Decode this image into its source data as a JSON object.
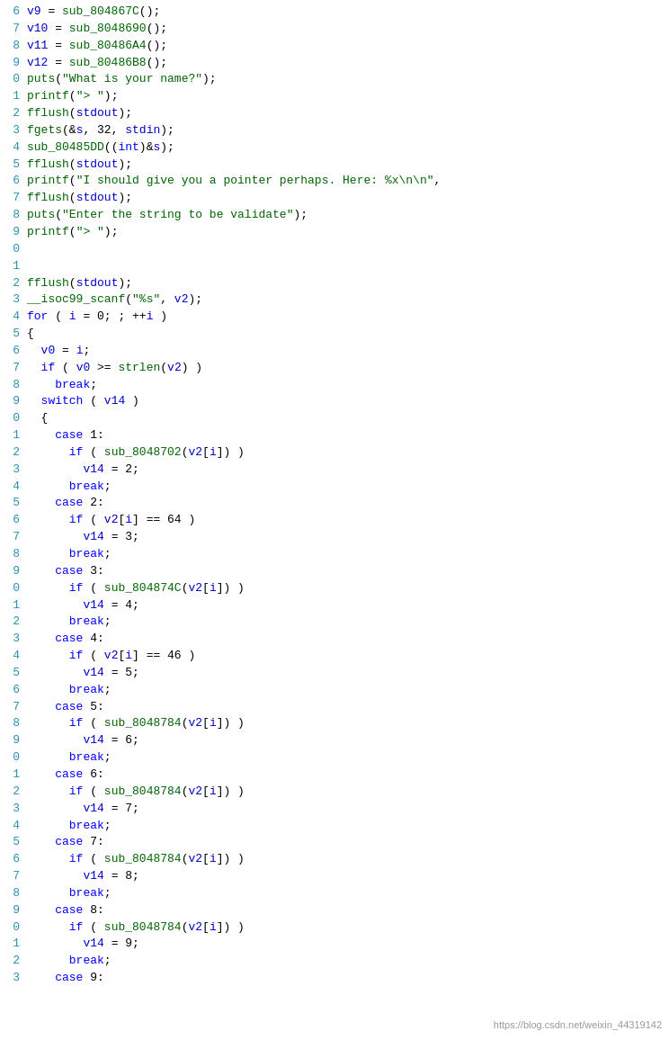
{
  "watermark": "https://blog.csdn.net/weixin_44319142",
  "lines": [
    {
      "num": "6",
      "html": "<span class='var'>v9</span><span class='plain'> = </span><span class='fn'>sub_804867C</span><span class='plain'>();</span>"
    },
    {
      "num": "7",
      "html": "<span class='var'>v10</span><span class='plain'> = </span><span class='fn'>sub_8048690</span><span class='plain'>();</span>"
    },
    {
      "num": "8",
      "html": "<span class='var'>v11</span><span class='plain'> = </span><span class='fn'>sub_80486A4</span><span class='plain'>();</span>"
    },
    {
      "num": "9",
      "html": "<span class='var'>v12</span><span class='plain'> = </span><span class='fn'>sub_80486B8</span><span class='plain'>();</span>"
    },
    {
      "num": "0",
      "html": "<span class='fn'>puts</span><span class='plain'>(</span><span class='str'>\"What is your name?\"</span><span class='plain'>);</span>"
    },
    {
      "num": "1",
      "html": "<span class='fn'>printf</span><span class='plain'>(</span><span class='str'>\"> \"</span><span class='plain'>);</span>"
    },
    {
      "num": "2",
      "html": "<span class='fn'>fflush</span><span class='plain'>(</span><span class='var'>stdout</span><span class='plain'>);</span>"
    },
    {
      "num": "3",
      "html": "<span class='fn'>fgets</span><span class='plain'>(&amp;</span><span class='var'>s</span><span class='plain'>, 32, </span><span class='var'>stdin</span><span class='plain'>);</span>"
    },
    {
      "num": "4",
      "html": "<span class='fn'>sub_80485DD</span><span class='plain'>((</span><span class='kw'>int</span><span class='plain'>)&amp;</span><span class='var'>s</span><span class='plain'>);</span>"
    },
    {
      "num": "5",
      "html": "<span class='fn'>fflush</span><span class='plain'>(</span><span class='var'>stdout</span><span class='plain'>);</span>"
    },
    {
      "num": "6",
      "html": "<span class='fn'>printf</span><span class='plain'>(</span><span class='str'>\"I should give you a pointer perhaps. Here: %x\\n\\n\"</span><span class='plain'>,</span>"
    },
    {
      "num": "7",
      "html": "<span class='fn'>fflush</span><span class='plain'>(</span><span class='var'>stdout</span><span class='plain'>);</span>"
    },
    {
      "num": "8",
      "html": "<span class='fn'>puts</span><span class='plain'>(</span><span class='str'>\"Enter the string to be validate\"</span><span class='plain'>);</span>"
    },
    {
      "num": "9",
      "html": "<span class='fn'>printf</span><span class='plain'>(</span><span class='str'>\"> \"</span><span class='plain'>);</span>"
    },
    {
      "num": "0",
      "html": ""
    },
    {
      "num": "1",
      "html": ""
    },
    {
      "num": "2",
      "html": "<span class='fn'>fflush</span><span class='plain'>(</span><span class='var'>stdout</span><span class='plain'>);</span>"
    },
    {
      "num": "3",
      "html": "<span class='fn'>__isoc99_scanf</span><span class='plain'>(</span><span class='str'>\"%s\"</span><span class='plain'>, </span><span class='var'>v2</span><span class='plain'>);</span>"
    },
    {
      "num": "4",
      "html": "<span class='kw'>for</span><span class='plain'> ( </span><span class='var'>i</span><span class='plain'> = 0; ; ++</span><span class='var'>i</span><span class='plain'> )</span>"
    },
    {
      "num": "5",
      "html": "<span class='plain'>{</span>"
    },
    {
      "num": "6",
      "html": "<span class='plain'>  </span><span class='var'>v0</span><span class='plain'> = </span><span class='var'>i</span><span class='plain'>;</span>"
    },
    {
      "num": "7",
      "html": "<span class='plain'>  </span><span class='kw'>if</span><span class='plain'> ( </span><span class='var'>v0</span><span class='plain'> &gt;= </span><span class='fn'>strlen</span><span class='plain'>(</span><span class='var'>v2</span><span class='plain'>) )</span>"
    },
    {
      "num": "8",
      "html": "<span class='plain'>    </span><span class='kw'>break</span><span class='plain'>;</span>"
    },
    {
      "num": "9",
      "html": "<span class='plain'>  </span><span class='kw'>switch</span><span class='plain'> ( </span><span class='var'>v14</span><span class='plain'> )</span>"
    },
    {
      "num": "0",
      "html": "<span class='plain'>  {</span>"
    },
    {
      "num": "1",
      "html": "<span class='plain'>    </span><span class='kw'>case</span><span class='plain'> 1:</span>"
    },
    {
      "num": "2",
      "html": "<span class='plain'>      </span><span class='kw'>if</span><span class='plain'> ( </span><span class='fn'>sub_8048702</span><span class='plain'>(</span><span class='var'>v2</span><span class='plain'>[</span><span class='var'>i</span><span class='plain'>]) )</span>"
    },
    {
      "num": "3",
      "html": "<span class='plain'>        </span><span class='var'>v14</span><span class='plain'> = 2;</span>"
    },
    {
      "num": "4",
      "html": "<span class='plain'>      </span><span class='kw'>break</span><span class='plain'>;</span>"
    },
    {
      "num": "5",
      "html": "<span class='plain'>    </span><span class='kw'>case</span><span class='plain'> 2:</span>"
    },
    {
      "num": "6",
      "html": "<span class='plain'>      </span><span class='kw'>if</span><span class='plain'> ( </span><span class='var'>v2</span><span class='plain'>[</span><span class='var'>i</span><span class='plain'>] == 64 )</span>"
    },
    {
      "num": "7",
      "html": "<span class='plain'>        </span><span class='var'>v14</span><span class='plain'> = 3;</span>"
    },
    {
      "num": "8",
      "html": "<span class='plain'>      </span><span class='kw'>break</span><span class='plain'>;</span>"
    },
    {
      "num": "9",
      "html": "<span class='plain'>    </span><span class='kw'>case</span><span class='plain'> 3:</span>"
    },
    {
      "num": "0",
      "html": "<span class='plain'>      </span><span class='kw'>if</span><span class='plain'> ( </span><span class='fn'>sub_804874C</span><span class='plain'>(</span><span class='var'>v2</span><span class='plain'>[</span><span class='var'>i</span><span class='plain'>]) )</span>"
    },
    {
      "num": "1",
      "html": "<span class='plain'>        </span><span class='var'>v14</span><span class='plain'> = 4;</span>"
    },
    {
      "num": "2",
      "html": "<span class='plain'>      </span><span class='kw'>break</span><span class='plain'>;</span>"
    },
    {
      "num": "3",
      "html": "<span class='plain'>    </span><span class='kw'>case</span><span class='plain'> 4:</span>"
    },
    {
      "num": "4",
      "html": "<span class='plain'>      </span><span class='kw'>if</span><span class='plain'> ( </span><span class='var'>v2</span><span class='plain'>[</span><span class='var'>i</span><span class='plain'>] == 46 )</span>"
    },
    {
      "num": "5",
      "html": "<span class='plain'>        </span><span class='var'>v14</span><span class='plain'> = 5;</span>"
    },
    {
      "num": "6",
      "html": "<span class='plain'>      </span><span class='kw'>break</span><span class='plain'>;</span>"
    },
    {
      "num": "7",
      "html": "<span class='plain'>    </span><span class='kw'>case</span><span class='plain'> 5:</span>"
    },
    {
      "num": "8",
      "html": "<span class='plain'>      </span><span class='kw'>if</span><span class='plain'> ( </span><span class='fn'>sub_8048784</span><span class='plain'>(</span><span class='var'>v2</span><span class='plain'>[</span><span class='var'>i</span><span class='plain'>]) )</span>"
    },
    {
      "num": "9",
      "html": "<span class='plain'>        </span><span class='var'>v14</span><span class='plain'> = 6;</span>"
    },
    {
      "num": "0",
      "html": "<span class='plain'>      </span><span class='kw'>break</span><span class='plain'>;</span>"
    },
    {
      "num": "1",
      "html": "<span class='plain'>    </span><span class='kw'>case</span><span class='plain'> 6:</span>"
    },
    {
      "num": "2",
      "html": "<span class='plain'>      </span><span class='kw'>if</span><span class='plain'> ( </span><span class='fn'>sub_8048784</span><span class='plain'>(</span><span class='var'>v2</span><span class='plain'>[</span><span class='var'>i</span><span class='plain'>]) )</span>"
    },
    {
      "num": "3",
      "html": "<span class='plain'>        </span><span class='var'>v14</span><span class='plain'> = 7;</span>"
    },
    {
      "num": "4",
      "html": "<span class='plain'>      </span><span class='kw'>break</span><span class='plain'>;</span>"
    },
    {
      "num": "5",
      "html": "<span class='plain'>    </span><span class='kw'>case</span><span class='plain'> 7:</span>"
    },
    {
      "num": "6",
      "html": "<span class='plain'>      </span><span class='kw'>if</span><span class='plain'> ( </span><span class='fn'>sub_8048784</span><span class='plain'>(</span><span class='var'>v2</span><span class='plain'>[</span><span class='var'>i</span><span class='plain'>]) )</span>"
    },
    {
      "num": "7",
      "html": "<span class='plain'>        </span><span class='var'>v14</span><span class='plain'> = 8;</span>"
    },
    {
      "num": "8",
      "html": "<span class='plain'>      </span><span class='kw'>break</span><span class='plain'>;</span>"
    },
    {
      "num": "9",
      "html": "<span class='plain'>    </span><span class='kw'>case</span><span class='plain'> 8:</span>"
    },
    {
      "num": "0",
      "html": "<span class='plain'>      </span><span class='kw'>if</span><span class='plain'> ( </span><span class='fn'>sub_8048784</span><span class='plain'>(</span><span class='var'>v2</span><span class='plain'>[</span><span class='var'>i</span><span class='plain'>]) )</span>"
    },
    {
      "num": "1",
      "html": "<span class='plain'>        </span><span class='var'>v14</span><span class='plain'> = 9;</span>"
    },
    {
      "num": "2",
      "html": "<span class='plain'>      </span><span class='kw'>break</span><span class='plain'>;</span>"
    },
    {
      "num": "3",
      "html": "<span class='plain'>    </span><span class='kw'>case</span><span class='plain'> 9:</span>"
    }
  ]
}
